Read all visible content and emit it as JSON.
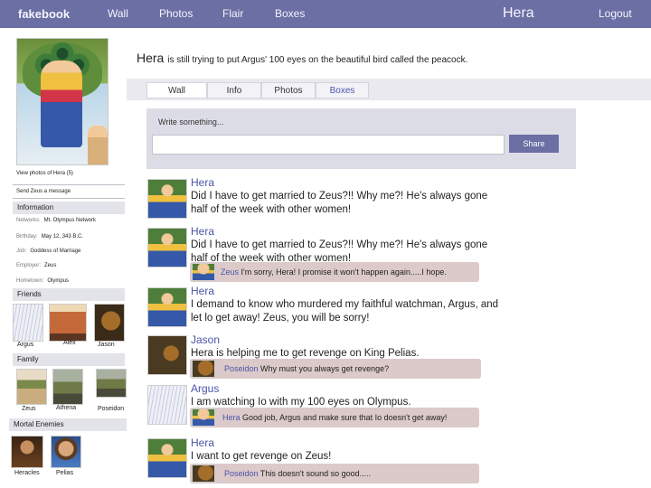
{
  "nav": {
    "logo": "fakebook",
    "links": [
      "Wall",
      "Photos",
      "Flair",
      "Boxes"
    ],
    "user": "Hera",
    "logout": "Logout"
  },
  "profile": {
    "name": "Hera",
    "status": "is still trying to put Argus' 100 eyes on the beautiful bird called the peacock."
  },
  "tabs": [
    "Wall",
    "Info",
    "Photos",
    "Boxes"
  ],
  "sidebar": {
    "view_photos": "View photos of Hera (5)",
    "send_message": "Send Zeus a message",
    "information_title": "Information",
    "info": [
      {
        "key": "Networks:",
        "value": "Mt. Olympus Network"
      },
      {
        "key": "Birthday:",
        "value": "May 12, 343 B.C."
      },
      {
        "key": "Job:",
        "value": "Goddess of Marriage"
      },
      {
        "key": "Employer:",
        "value": "Zeus"
      },
      {
        "key": "Hometown:",
        "value": "Olympus"
      }
    ],
    "friends_title": "Friends",
    "friends": [
      "Argus",
      "Alex",
      "Jason"
    ],
    "family_title": "Family",
    "family": [
      "Zeus",
      "Athena",
      "Poseidon"
    ],
    "enemies_title": "Mortal Enemies",
    "enemies": [
      "Heracles",
      "Pelias"
    ]
  },
  "composer": {
    "placeholder": "Write something...",
    "share": "Share"
  },
  "posts": [
    {
      "author": "Hera",
      "text": "Did I have to get married to Zeus?!! Why me?! He's always gone half of the week with other women!"
    },
    {
      "author": "Hera",
      "text": "Did I have to get married to Zeus?!! Why me?! He's always gone half of the week with other women!",
      "comment": {
        "author": "Zeus",
        "text": "I'm sorry, Hera! I promise it won't happen again.....I hope."
      }
    },
    {
      "author": "Hera",
      "text": "I demand to know who murdered my faithful watchman, Argus, and let lo get away! Zeus, you will be sorry!"
    },
    {
      "author": "Jason",
      "text": "Hera is helping me to get revenge on King Pelias.",
      "comment": {
        "author": "Poseidon",
        "text": "Why must you always get revenge?"
      }
    },
    {
      "author": "Argus",
      "text": "I am watching Io with my 100 eyes on Olympus.",
      "comment": {
        "author": "Hera",
        "text": "Good job, Argus and make sure that Io doesn't get away!"
      }
    },
    {
      "author": "Hera",
      "text": "I want to get revenge on Zeus!",
      "comment": {
        "author": "Poseidon",
        "text": "This doesn't sound so good....."
      }
    }
  ]
}
